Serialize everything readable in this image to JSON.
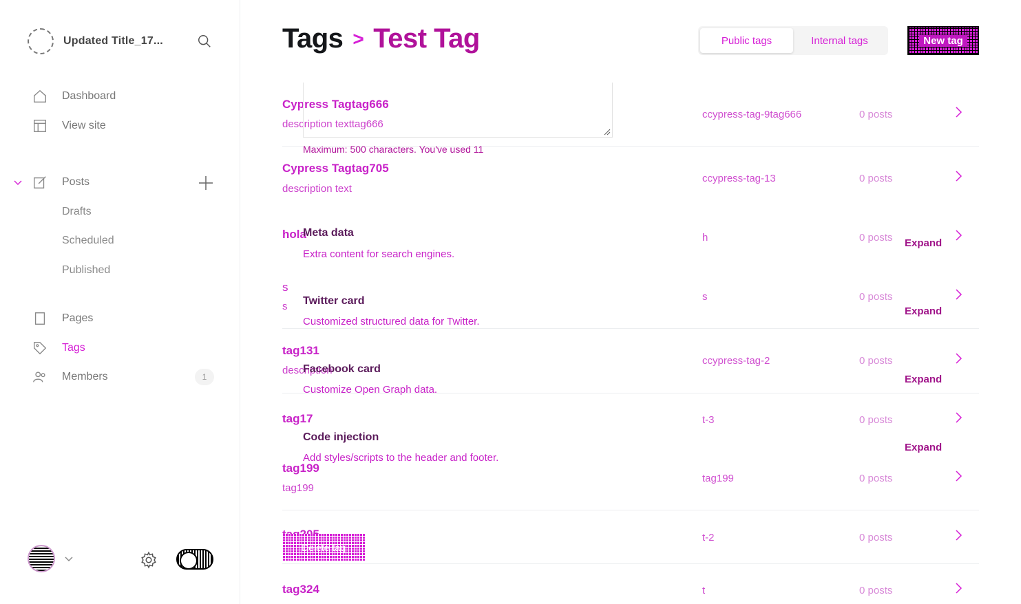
{
  "sidebar": {
    "site_title": "Updated Title_17...",
    "nav": {
      "dashboard": "Dashboard",
      "view_site": "View site",
      "posts": "Posts",
      "drafts": "Drafts",
      "scheduled": "Scheduled",
      "published": "Published",
      "pages": "Pages",
      "tags": "Tags",
      "members": "Members",
      "members_count": "1"
    }
  },
  "header": {
    "crumb": "Tags",
    "separator": ">",
    "current": "Test Tag",
    "tabs": [
      "Public tags",
      "Internal tags"
    ],
    "new_button": "New tag"
  },
  "tags": [
    {
      "name": "Cypress Tagtag666",
      "description": "description texttag666",
      "slug": "ccypress-tag-9tag666",
      "posts": "0 posts"
    },
    {
      "name": "Cypress Tagtag705",
      "description": "description text",
      "slug": "ccypress-tag-13",
      "posts": "0 posts"
    },
    {
      "name": "hola",
      "description": "",
      "slug": "h",
      "posts": "0 posts"
    },
    {
      "name": "s",
      "description": "s",
      "slug": "s",
      "posts": "0 posts"
    },
    {
      "name": "tag131",
      "description": "description",
      "slug": "ccypress-tag-2",
      "posts": "0 posts"
    },
    {
      "name": "tag17",
      "description": "",
      "slug": "t-3",
      "posts": "0 posts"
    },
    {
      "name": "tag199",
      "description": "tag199",
      "slug": "tag199",
      "posts": "0 posts"
    },
    {
      "name": "tag205",
      "description": "",
      "slug": "t-2",
      "posts": "0 posts"
    },
    {
      "name": "tag324",
      "description": "",
      "slug": "t",
      "posts": "0 posts"
    }
  ],
  "overlay": {
    "char_hint": "Maximum: 500 characters. You've used 11",
    "sections": [
      {
        "title": "Meta data",
        "subtitle": "Extra content for search engines.",
        "action": "Expand"
      },
      {
        "title": "Twitter card",
        "subtitle": "Customized structured data for Twitter.",
        "action": "Expand"
      },
      {
        "title": "Facebook card",
        "subtitle": "Customize Open Graph data.",
        "action": "Expand"
      },
      {
        "title": "Code injection",
        "subtitle": "Add styles/scripts to the header and footer.",
        "action": "Expand"
      }
    ],
    "delete_button": "Delete tag"
  },
  "colors": {
    "accent": "#d61fd6",
    "accent_dark": "#b0129a"
  },
  "icons": [
    "search-icon",
    "home-icon",
    "view-site-icon",
    "posts-icon",
    "plus-icon",
    "pages-icon",
    "tag-icon",
    "members-icon",
    "chevron-right-icon",
    "gear-icon",
    "chevron-down-icon"
  ]
}
